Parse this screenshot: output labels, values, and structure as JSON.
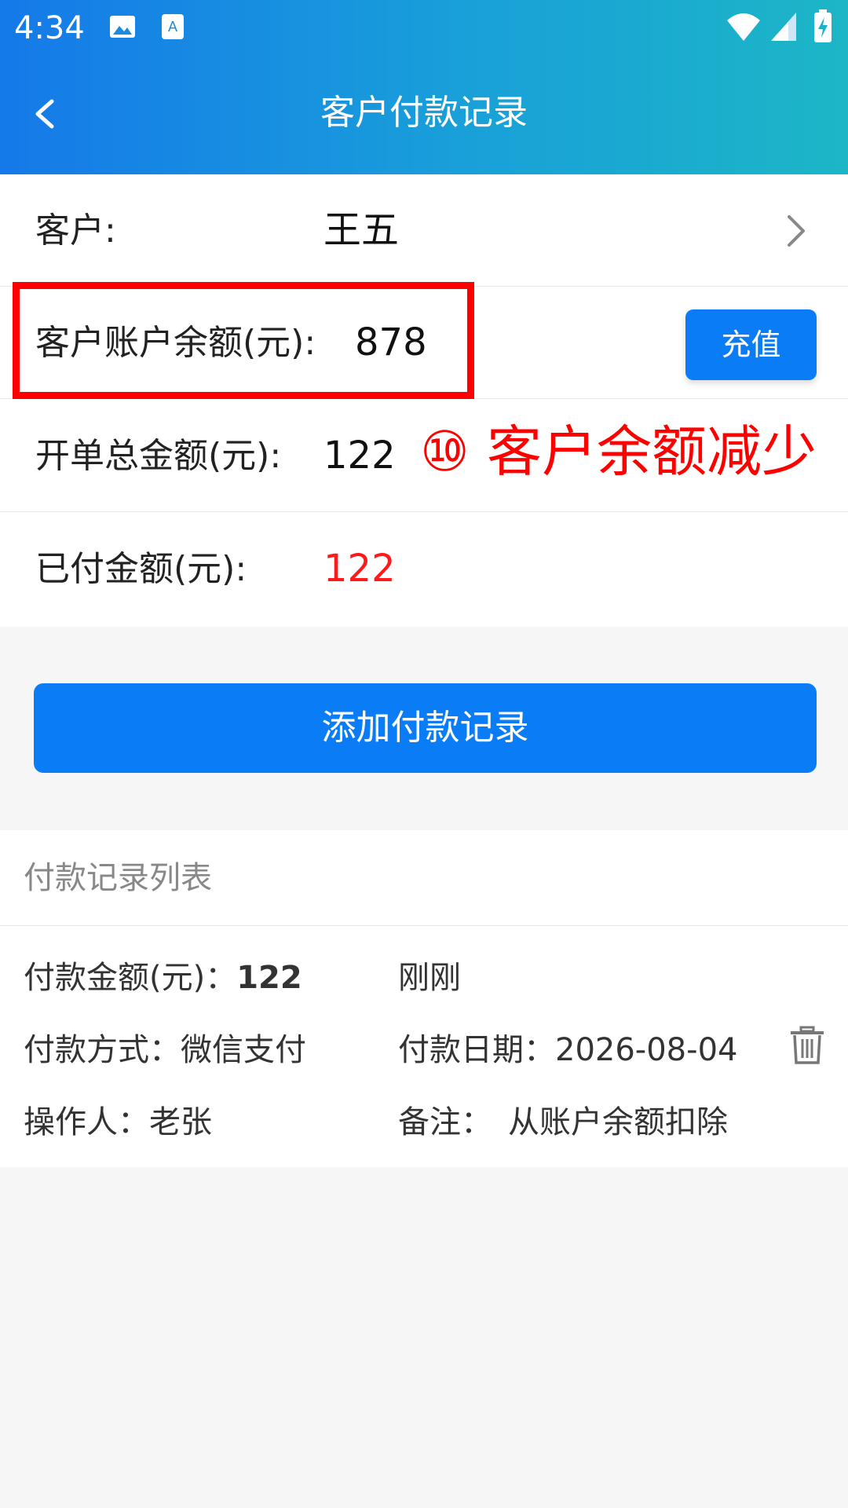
{
  "status_bar": {
    "time": "4:34"
  },
  "header": {
    "title": "客户付款记录"
  },
  "info": {
    "customer_label": "客户:",
    "customer_value": "王五",
    "balance_label": "客户账户余额(元):",
    "balance_value": "878",
    "recharge_label": "充值",
    "total_label": "开单总金额(元):",
    "total_value": "122",
    "paid_label": "已付金额(元):",
    "paid_value": "122"
  },
  "annotation": {
    "text": "⑩ 客户余额减少"
  },
  "add_button": {
    "label": "添加付款记录"
  },
  "list": {
    "title": "付款记录列表",
    "records": [
      {
        "amount_label": "付款金额(元)：",
        "amount_value": "122",
        "time_text": "刚刚",
        "method_label": "付款方式：",
        "method_value": "微信支付",
        "date_label": "付款日期：",
        "date_value": "2026-08-04",
        "operator_label": "操作人：",
        "operator_value": "老张",
        "remark_label": "备注：",
        "remark_value": "从账户余额扣除"
      }
    ]
  },
  "colors": {
    "accent": "#0a7df6",
    "paid_value": "#ff1a1a",
    "annotation": "#ff0000"
  }
}
